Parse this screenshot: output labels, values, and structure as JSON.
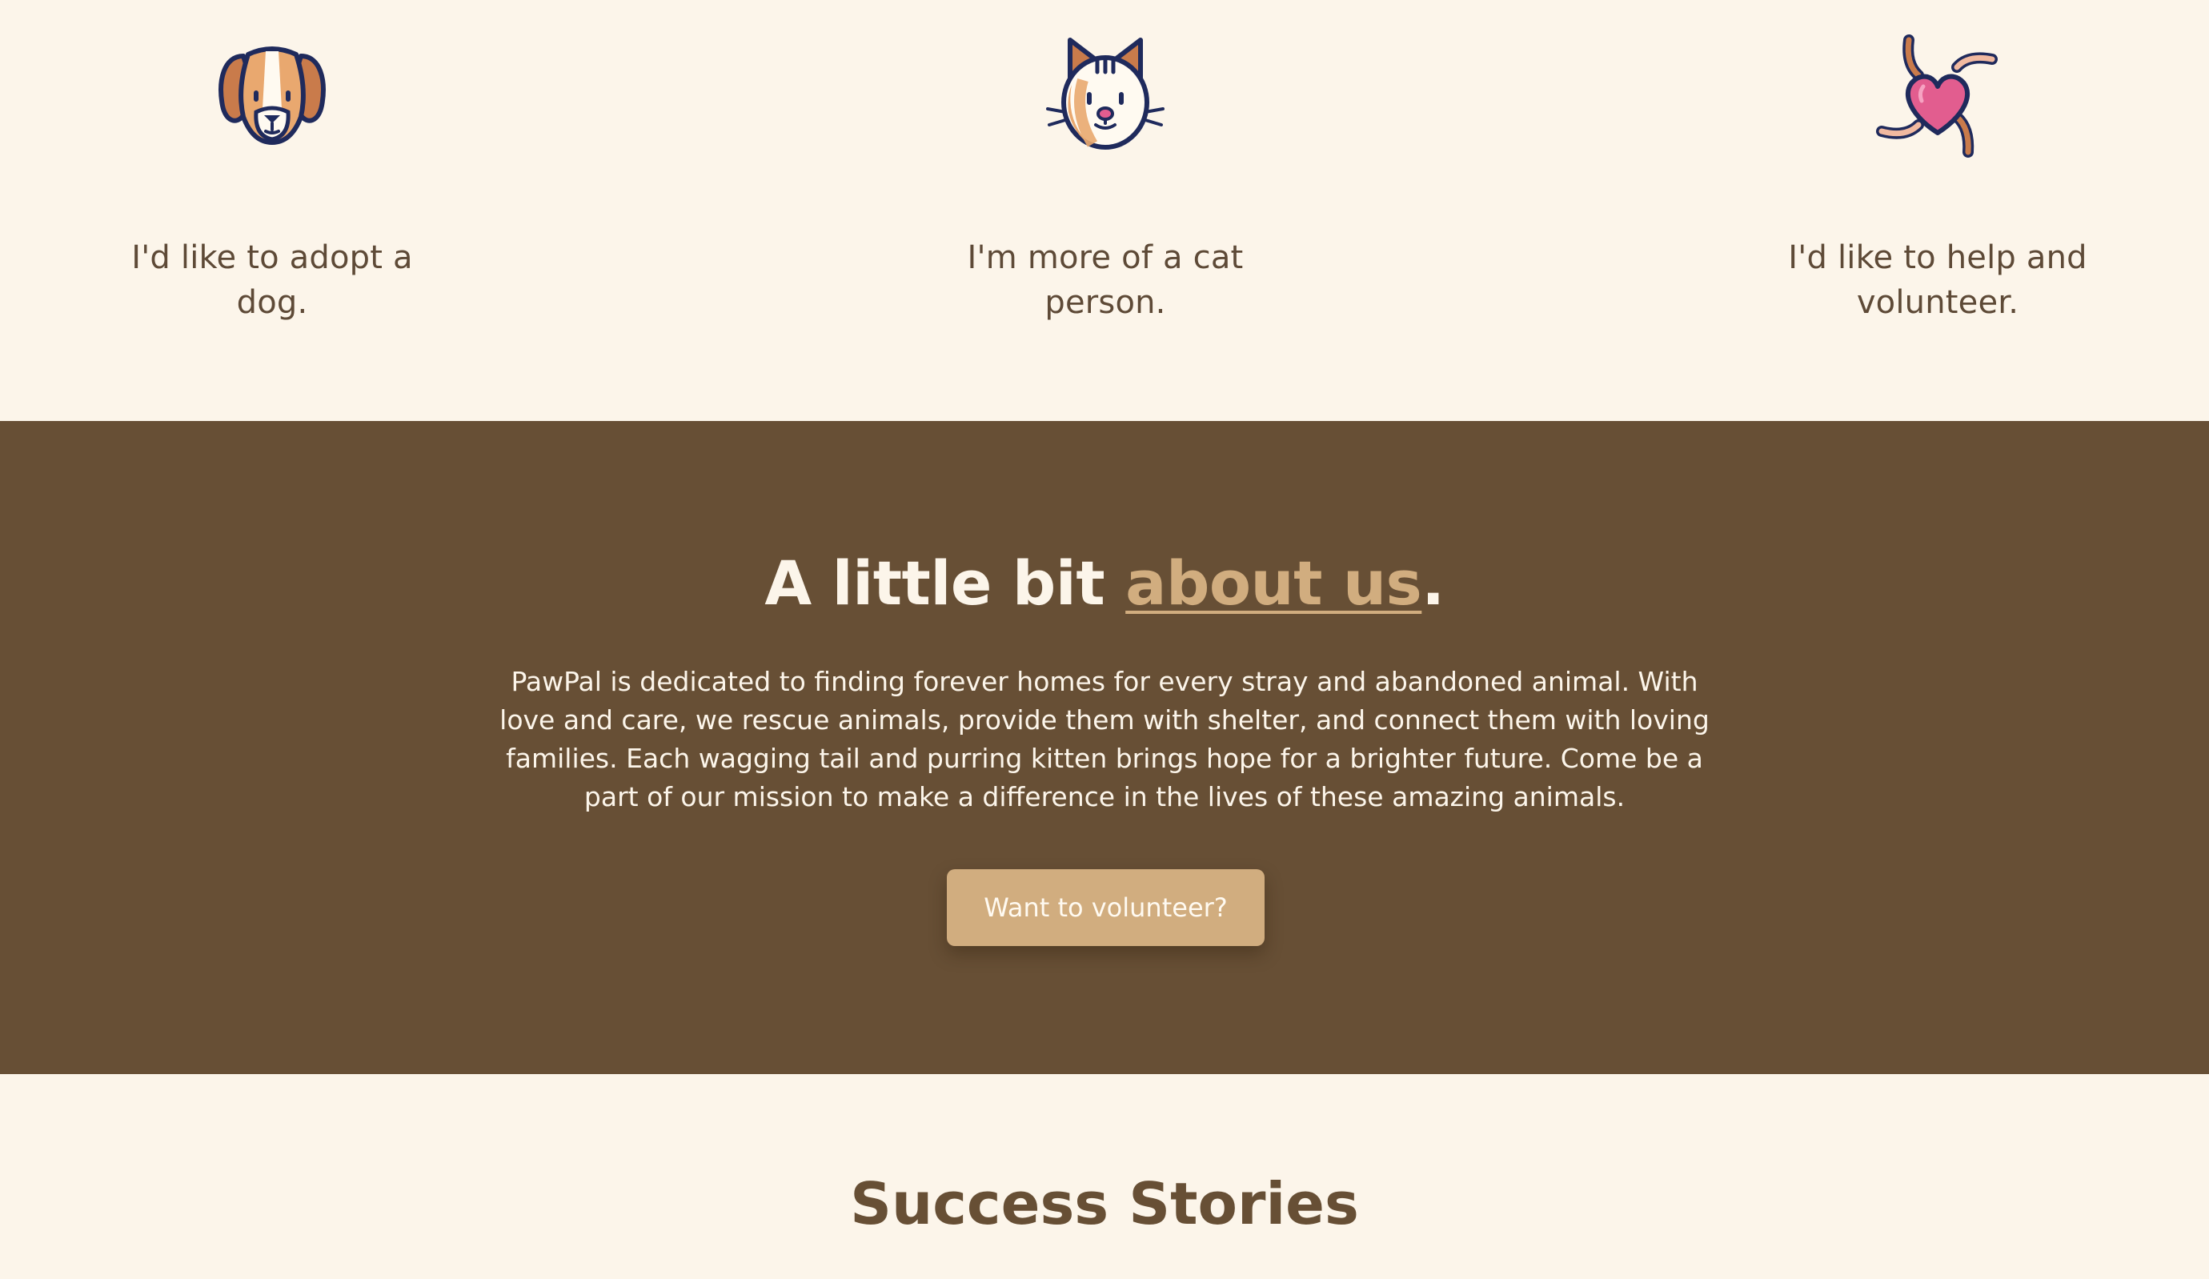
{
  "options": [
    {
      "icon": "dog-icon",
      "label": "I'd like to adopt a dog."
    },
    {
      "icon": "cat-icon",
      "label": "I'm more of a cat person."
    },
    {
      "icon": "heart-hands-icon",
      "label": "I'd like to help and volunteer."
    }
  ],
  "about": {
    "heading_prefix": "A little bit ",
    "heading_link": "about us",
    "heading_suffix": ".",
    "body": "PawPal is dedicated to finding forever homes for every stray and abandoned animal. With love and care, we rescue animals, provide them with shelter, and connect them with loving families. Each wagging tail and purring kitten brings hope for a brighter future. Come be a part of our mission to make a difference in the lives of these amazing animals.",
    "button_label": "Want to volunteer?"
  },
  "success": {
    "heading": "Success Stories"
  },
  "colors": {
    "background": "#fcf5ea",
    "brown": "#674f35",
    "tan": "#d1ad7f",
    "navy": "#1f2a5c",
    "pink": "#e25d8f"
  }
}
